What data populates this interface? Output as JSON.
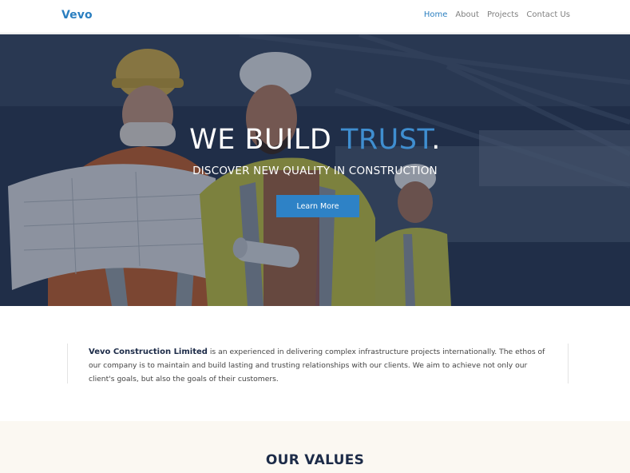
{
  "nav": {
    "brand": "Vevo",
    "links": [
      {
        "label": "Home",
        "active": true
      },
      {
        "label": "About",
        "active": false
      },
      {
        "label": "Projects",
        "active": false
      },
      {
        "label": "Contact Us",
        "active": false
      }
    ]
  },
  "hero": {
    "title_main": "WE BUILD ",
    "title_accent": "TRUST",
    "title_end": ".",
    "subtitle": "DISCOVER NEW QUALITY IN CONSTRUCTION",
    "button_label": "Learn More"
  },
  "about": {
    "company_name": "Vevo Construction Limited",
    "description": " is an experienced in delivering complex infrastructure projects internationally. The ethos of our company is to maintain and build lasting and trusting relationships with our clients. We aim to achieve not only our client's goals, but also the goals of their customers."
  },
  "values": {
    "title": "OUR VALUES"
  },
  "colors": {
    "accent": "#2b7fc0",
    "button": "#2e82c6",
    "dark_text": "#1c2b48",
    "values_bg": "#fbf8f2"
  }
}
